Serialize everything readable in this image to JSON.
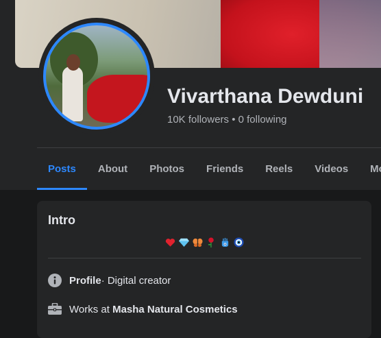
{
  "profile": {
    "name": "Vivarthana Dewduni",
    "followers_line": "10K followers • 0 following"
  },
  "tabs": [
    {
      "label": "Posts",
      "active": true
    },
    {
      "label": "About"
    },
    {
      "label": "Photos"
    },
    {
      "label": "Friends"
    },
    {
      "label": "Reels"
    },
    {
      "label": "Videos"
    },
    {
      "label": "More"
    }
  ],
  "intro": {
    "title": "Intro",
    "bio_emojis": [
      "heart",
      "gem",
      "butterfly",
      "rose",
      "hamsa",
      "nazar-amulet"
    ],
    "rows": [
      {
        "icon": "info-icon",
        "bold": "Profile",
        "rest": " · Digital creator"
      },
      {
        "icon": "briefcase-icon",
        "prefix": "Works at ",
        "bold": "Masha Natural Cosmetics"
      }
    ]
  },
  "colors": {
    "accent": "#2d88ff",
    "background": "#18191a",
    "surface": "#242526",
    "secondary_text": "#b0b3b8"
  }
}
